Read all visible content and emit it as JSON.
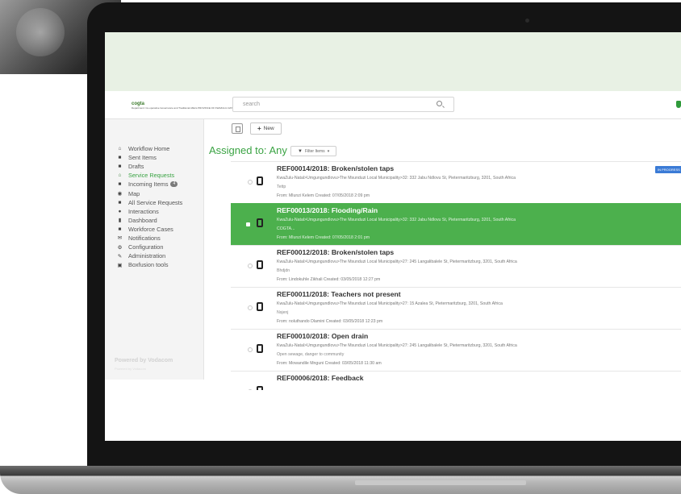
{
  "app": {
    "logo_title": "cogta",
    "logo_sub": "Department: Co-operative Governance and Traditional Affairs PROVINCE OF KWAZULU-NATAL"
  },
  "search": {
    "placeholder": "search"
  },
  "sidebar": {
    "items": [
      {
        "label": "Workflow Home",
        "icon": "home-icon",
        "glyph": "⌂",
        "active": false
      },
      {
        "label": "Sent Items",
        "icon": "briefcase-icon",
        "glyph": "■",
        "active": false
      },
      {
        "label": "Drafts",
        "icon": "briefcase-icon",
        "glyph": "■",
        "active": false
      },
      {
        "label": "Service Requests",
        "icon": "home-icon",
        "glyph": "⌂",
        "active": true
      },
      {
        "label": "Incoming Items",
        "icon": "briefcase-icon",
        "glyph": "■",
        "active": false,
        "count": "4"
      },
      {
        "label": "Map",
        "icon": "map-pin-icon",
        "glyph": "◉",
        "active": false
      },
      {
        "label": "All Service Requests",
        "icon": "briefcase-icon",
        "glyph": "■",
        "active": false
      },
      {
        "label": "Interactions",
        "icon": "user-icon",
        "glyph": "●",
        "active": false
      },
      {
        "label": "Dashboard",
        "icon": "bar-chart-icon",
        "glyph": "▮",
        "active": false
      },
      {
        "label": "Workforce Cases",
        "icon": "briefcase-icon",
        "glyph": "■",
        "active": false
      },
      {
        "label": "Notifications",
        "icon": "envelope-icon",
        "glyph": "✉",
        "active": false
      },
      {
        "label": "Configuration",
        "icon": "gear-icon",
        "glyph": "⚙",
        "active": false
      },
      {
        "label": "Administration",
        "icon": "wrench-icon",
        "glyph": "✎",
        "active": false
      },
      {
        "label": "Boxfusion tools",
        "icon": "box-icon",
        "glyph": "▣",
        "active": false
      }
    ],
    "powered_by": "Powered by Vodacom",
    "powered_sub": "Powered by Vodacom"
  },
  "toolbar": {
    "new_label": "New"
  },
  "main": {
    "heading": "Assigned to: Any",
    "filter_label": "Filter Items"
  },
  "requests": [
    {
      "title": "REF00014/2018: Broken/stolen taps",
      "address": "KwaZulu-Natal>Umgungundlovu>The Msunduzi Local Municipality>32: 332 Jabu Ndlovu St, Pietermaritzburg, 3201, South Africa",
      "description": "Tettp",
      "meta": "From: Mlunzi Kelem Created: 07/05/2018 2:09 pm",
      "status": "IN PROGRESS",
      "selected": false
    },
    {
      "title": "REF00013/2018: Flooding/Rain",
      "address": "KwaZulu-Natal>Umgungundlovu>The Msunduzi Local Municipality>32: 332 Jabu Ndlovu St, Pietermaritzburg, 3201, South Africa",
      "description": "COGTA...",
      "meta": "From: Mlunzi Kelem Created: 07/05/2018 2:01 pm",
      "status": "",
      "selected": true
    },
    {
      "title": "REF00012/2018: Broken/stolen taps",
      "address": "KwaZulu-Natal>Umgungundlovu>The Msunduzi Local Municipality>27: 245 Langalibalele St, Pietermaritzburg, 3201, South Africa",
      "description": "Bhdjdn",
      "meta": "From: Lindokuhle Zikhali Created: 03/05/2018 12:27 pm",
      "status": "",
      "selected": false
    },
    {
      "title": "REF00011/2018: Teachers not present",
      "address": "KwaZulu-Natal>Umgungundlovu>The Msunduzi Local Municipality>27: 15 Azalea St, Pietermaritzburg, 3201, South Africa",
      "description": "Nsjenj",
      "meta": "From: noluthando Dlamini Created: 03/05/2018 12:23 pm",
      "status": "",
      "selected": false
    },
    {
      "title": "REF00010/2018: Open drain",
      "address": "KwaZulu-Natal>Umgungundlovu>The Msunduzi Local Municipality>27: 245 Langalibalele St, Pietermaritzburg, 3201, South Africa",
      "description": "Open sewage, danger to community",
      "meta": "From: Mowandile Mnguni Created: 03/05/2018 11:30 am",
      "status": "",
      "selected": false
    },
    {
      "title": "REF00006/2018: Feedback",
      "address": "",
      "description": "",
      "meta": "",
      "status": "",
      "selected": false
    }
  ]
}
